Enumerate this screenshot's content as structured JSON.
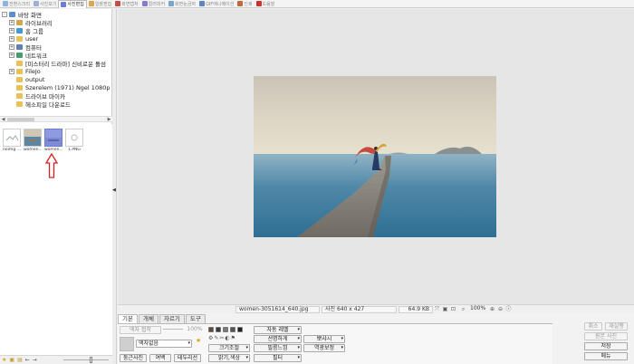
{
  "top_tabs": [
    {
      "label": "전환스크리",
      "color": "#8fb3de"
    },
    {
      "label": "사진보기",
      "color": "#9fb0d6"
    },
    {
      "label": "사진편집",
      "color": "#6c7bd6"
    },
    {
      "label": "일괄편집",
      "color": "#d9a94d"
    },
    {
      "label": "화면캡처",
      "color": "#c94a4a"
    },
    {
      "label": "컬러피커",
      "color": "#8a7ac9"
    },
    {
      "label": "화면눈금자",
      "color": "#7aa6c9"
    },
    {
      "label": "GIF애니메이션",
      "color": "#5f86c2"
    },
    {
      "label": "인쇄",
      "color": "#c06a3c"
    },
    {
      "label": "도움말",
      "color": "#d03030"
    }
  ],
  "active_top_tab": "사진편집",
  "tree": [
    {
      "label": "바탕 화면",
      "icon": "desktop-icon",
      "depth": 0,
      "expander": "-"
    },
    {
      "label": "라이브러리",
      "icon": "library-icon",
      "depth": 1,
      "expander": "+"
    },
    {
      "label": "홈 그룹",
      "icon": "homegroup-icon",
      "depth": 1,
      "expander": "+"
    },
    {
      "label": "user",
      "icon": "folder-icon",
      "depth": 1,
      "expander": "+"
    },
    {
      "label": "컴퓨터",
      "icon": "computer-icon",
      "depth": 1,
      "expander": "+"
    },
    {
      "label": "네트워크",
      "icon": "network-icon",
      "depth": 1,
      "expander": "+"
    },
    {
      "label": "[미스터리 드라마] 신비로운 돌섬",
      "icon": "folder-icon",
      "depth": 1,
      "expander": ""
    },
    {
      "label": "FileJo",
      "icon": "folder-icon",
      "depth": 1,
      "expander": "+"
    },
    {
      "label": "output",
      "icon": "folder-icon",
      "depth": 1,
      "expander": ""
    },
    {
      "label": "Szerelem (1971) Ngel 1080p HD",
      "icon": "folder-icon",
      "depth": 1,
      "expander": ""
    },
    {
      "label": "드라이브 마이카",
      "icon": "folder-icon",
      "depth": 1,
      "expander": ""
    },
    {
      "label": "헤소피일 다운로드",
      "icon": "folder-icon",
      "depth": 1,
      "expander": ""
    }
  ],
  "thumbnails": [
    {
      "caption": "noimg ...",
      "selected": false
    },
    {
      "caption": "women...",
      "selected": false
    },
    {
      "caption": "women...",
      "selected": true
    },
    {
      "caption": "1.PNG",
      "selected": false
    }
  ],
  "status": {
    "filename": "women-3051614_640.jpg",
    "dimensions": "사진 640 x 427",
    "filesize": "64.9 KB",
    "zoom": "100%"
  },
  "bottom_tabs": [
    "기본",
    "개체",
    "자르기",
    "도구"
  ],
  "bottom": {
    "frame_btn": "액자 접착",
    "frame_pct": "100%",
    "frame_select": "액자없음",
    "left_buttons": [
      "둥근사진",
      "여백",
      "테두리선"
    ],
    "mid_buttons": [
      "크기조절",
      "밝기,색상"
    ],
    "mid2_buttons": [
      "선명하게",
      "필름느낌",
      "필터"
    ],
    "auto_level": "자동 레벨",
    "right_buttons": [
      "뽀샤시",
      "역광보정"
    ],
    "swatches": [
      "#6b4a2f",
      "#3a3a3a",
      "#7a7a7a",
      "#555555",
      "#222222"
    ]
  },
  "side_buttons": {
    "cancel": "취소",
    "redo": "재실행",
    "original": "원본 사진",
    "save": "저장",
    "menu": "메뉴"
  }
}
